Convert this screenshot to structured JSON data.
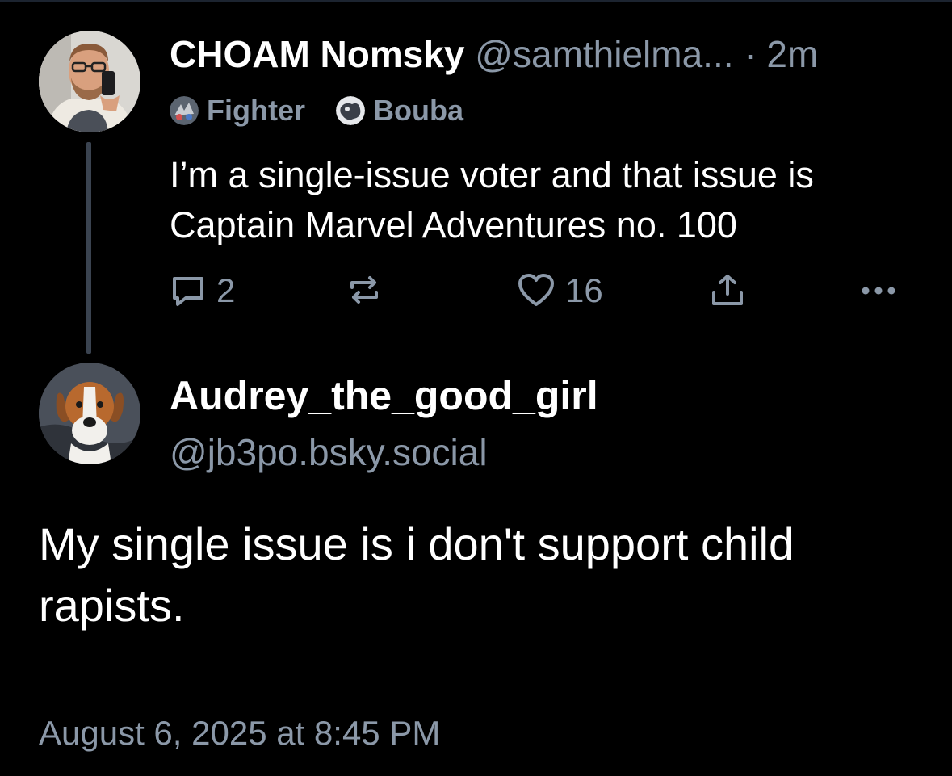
{
  "parent_post": {
    "author_name": "CHOAM Nomsky",
    "author_handle": "@samthielma...",
    "separator": "·",
    "time_ago": "2m",
    "badges": [
      {
        "label": "Fighter",
        "icon": "fighter-icon"
      },
      {
        "label": "Bouba",
        "icon": "bouba-icon"
      }
    ],
    "text": "I’m a single-issue voter and that issue is Captain Marvel Adventures no. 100",
    "reply_count": "2",
    "repost_count": "",
    "like_count": "16"
  },
  "reply_post": {
    "author_name": "Audrey_the_good_girl",
    "author_handle": "@jb3po.bsky.social",
    "text": "My single issue is i don't support child rapists.",
    "timestamp": "August 6, 2025 at 8:45 PM"
  },
  "colors": {
    "background": "#000000",
    "text": "#ffffff",
    "muted": "#8b98a8",
    "thread_line": "#3a4350"
  }
}
